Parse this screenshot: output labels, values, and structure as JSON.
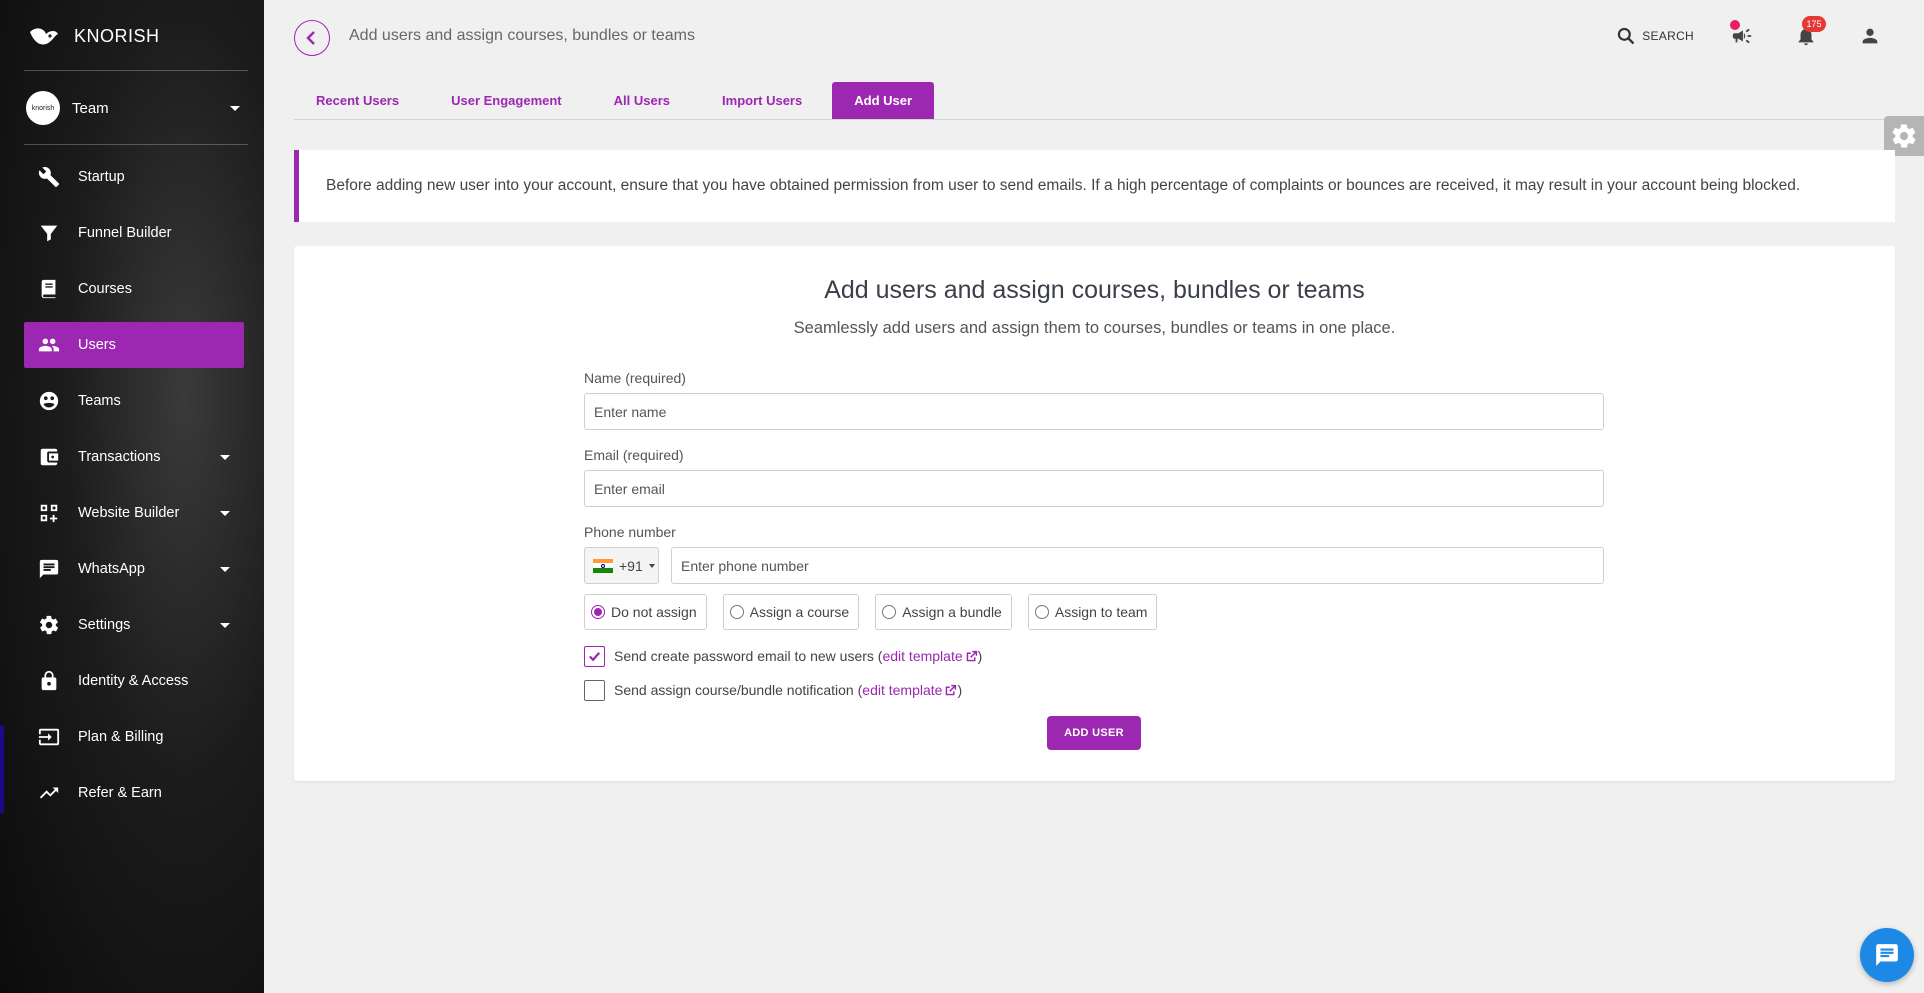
{
  "brand": {
    "name": "KNORISH"
  },
  "team": {
    "label": "Team",
    "avatar_text": "knorish"
  },
  "sidebar": {
    "items": [
      {
        "label": "Startup",
        "icon": "wrench-icon",
        "active": false,
        "caret": false
      },
      {
        "label": "Funnel Builder",
        "icon": "funnel-icon",
        "active": false,
        "caret": false
      },
      {
        "label": "Courses",
        "icon": "book-icon",
        "active": false,
        "caret": false
      },
      {
        "label": "Users",
        "icon": "users-icon",
        "active": true,
        "caret": false
      },
      {
        "label": "Teams",
        "icon": "teams-icon",
        "active": false,
        "caret": false
      },
      {
        "label": "Transactions",
        "icon": "wallet-icon",
        "active": false,
        "caret": true
      },
      {
        "label": "Website Builder",
        "icon": "website-icon",
        "active": false,
        "caret": true
      },
      {
        "label": "WhatsApp",
        "icon": "chat-icon",
        "active": false,
        "caret": true
      },
      {
        "label": "Settings",
        "icon": "gear-icon",
        "active": false,
        "caret": true
      },
      {
        "label": "Identity & Access",
        "icon": "lock-icon",
        "active": false,
        "caret": false
      },
      {
        "label": "Plan & Billing",
        "icon": "billing-icon",
        "active": false,
        "caret": false
      },
      {
        "label": "Refer & Earn",
        "icon": "trend-icon",
        "active": false,
        "caret": false
      }
    ]
  },
  "header": {
    "title": "Add users and assign courses, bundles or teams",
    "search_label": "SEARCH",
    "notification_count": "175"
  },
  "tabs": [
    {
      "label": "Recent Users",
      "active": false
    },
    {
      "label": "User Engagement",
      "active": false
    },
    {
      "label": "All Users",
      "active": false
    },
    {
      "label": "Import Users",
      "active": false
    },
    {
      "label": "Add User",
      "active": true
    }
  ],
  "notice": "Before adding new user into your account, ensure that you have obtained permission from user to send emails. If a high percentage of complaints or bounces are received, it may result in your account being blocked.",
  "form": {
    "title": "Add users and assign courses, bundles or teams",
    "subtitle": "Seamlessly add users and assign them to courses, bundles or teams in one place.",
    "name_label": "Name (required)",
    "name_placeholder": "Enter name",
    "email_label": "Email (required)",
    "email_placeholder": "Enter email",
    "phone_label": "Phone number",
    "country_code": "+91",
    "phone_placeholder": "Enter phone number",
    "assign_options": [
      {
        "label": "Do not assign",
        "selected": true
      },
      {
        "label": "Assign a course",
        "selected": false
      },
      {
        "label": "Assign a bundle",
        "selected": false
      },
      {
        "label": "Assign to team",
        "selected": false
      }
    ],
    "check_password": {
      "text": "Send create password email to new users (",
      "link": "edit template",
      "close": ")",
      "checked": true
    },
    "check_notify": {
      "text": "Send assign course/bundle notification (",
      "link": "edit template",
      "close": ")",
      "checked": false
    },
    "submit_label": "ADD USER"
  },
  "colors": {
    "accent": "#9c27b0",
    "chat": "#1e88e5",
    "badge": "#e53935"
  }
}
